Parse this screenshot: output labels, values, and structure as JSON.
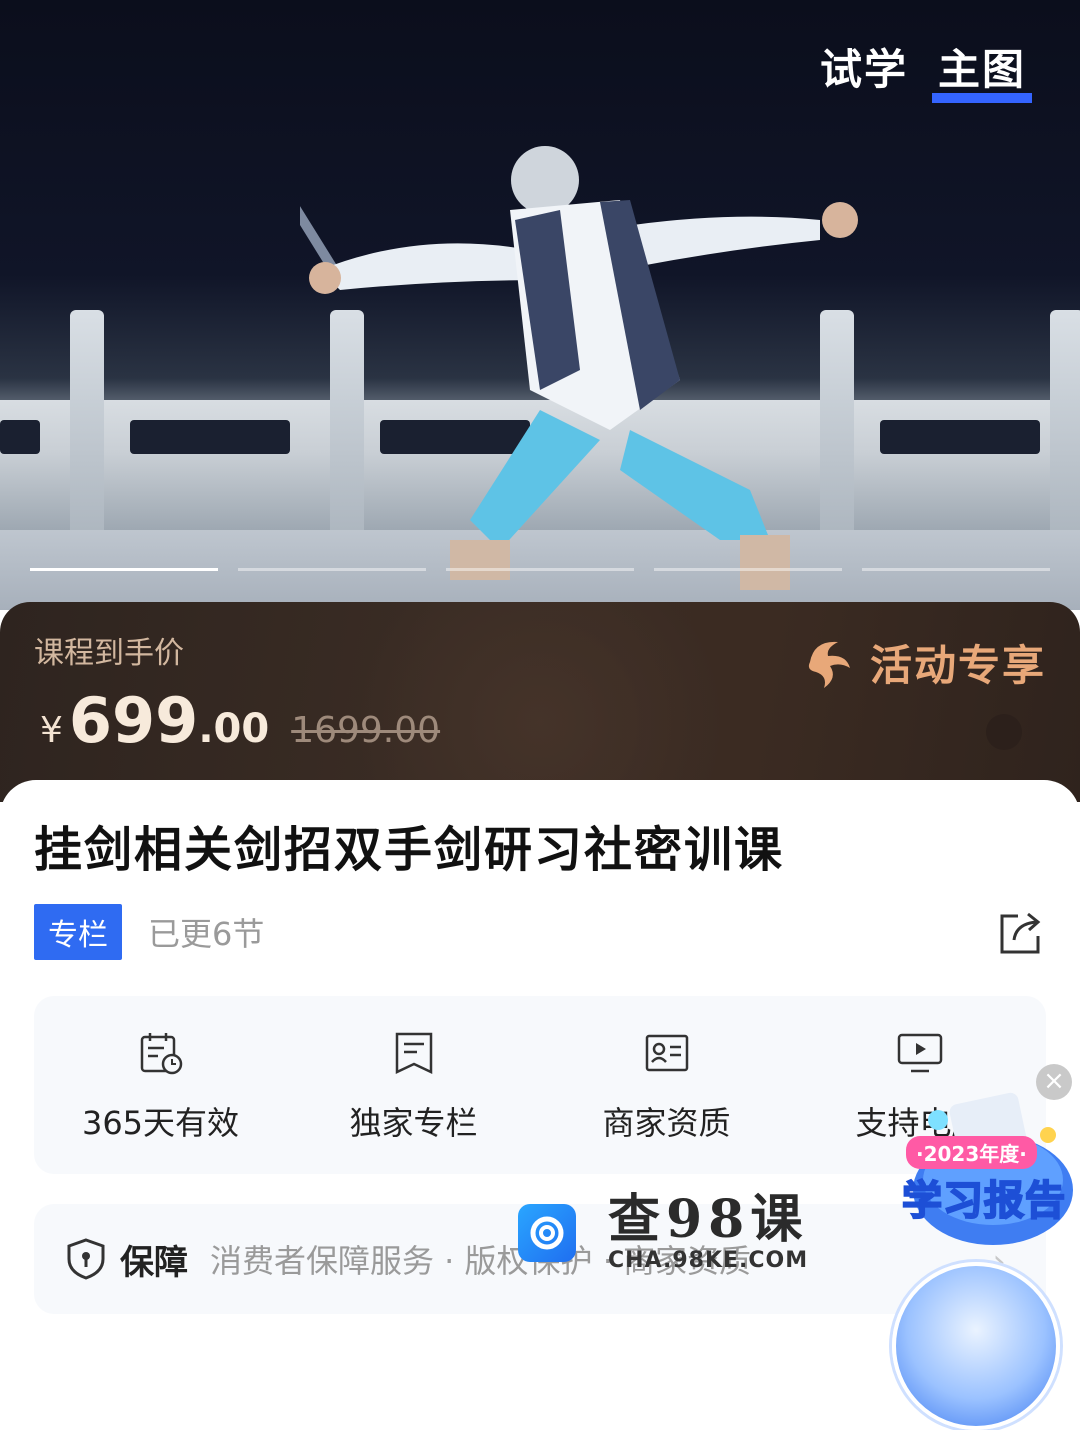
{
  "hero": {
    "tabs": [
      {
        "label": "试学",
        "active": false
      },
      {
        "label": "主图",
        "active": true
      }
    ],
    "slide_count": 5,
    "active_slide": 1
  },
  "price": {
    "label": "课程到手价",
    "currency": "¥",
    "integer": "699",
    "decimal": ".00",
    "original": "1699.00",
    "activity_label": "活动专享"
  },
  "course": {
    "title": "挂剑相关剑招双手剑研习社密训课",
    "tag": "专栏",
    "updated": "已更6节"
  },
  "features": [
    {
      "label": "365天有效",
      "icon": "calendar-clock-icon"
    },
    {
      "label": "独家专栏",
      "icon": "bookmark-doc-icon"
    },
    {
      "label": "商家资质",
      "icon": "id-card-icon"
    },
    {
      "label": "支持电脑",
      "icon": "monitor-play-icon"
    }
  ],
  "guarantee": {
    "title": "保障",
    "text": "消费者保障服务 · 版权保护 · 商家资质"
  },
  "watermark": {
    "cn": "查98课",
    "en": "CHA.98KE.COM"
  },
  "report_badge": {
    "year": "·2023年度·",
    "title": "学习报告"
  },
  "colors": {
    "accent": "#2f6bf2",
    "banner_bg": "#3a2c24",
    "activity": "#e8a879"
  }
}
